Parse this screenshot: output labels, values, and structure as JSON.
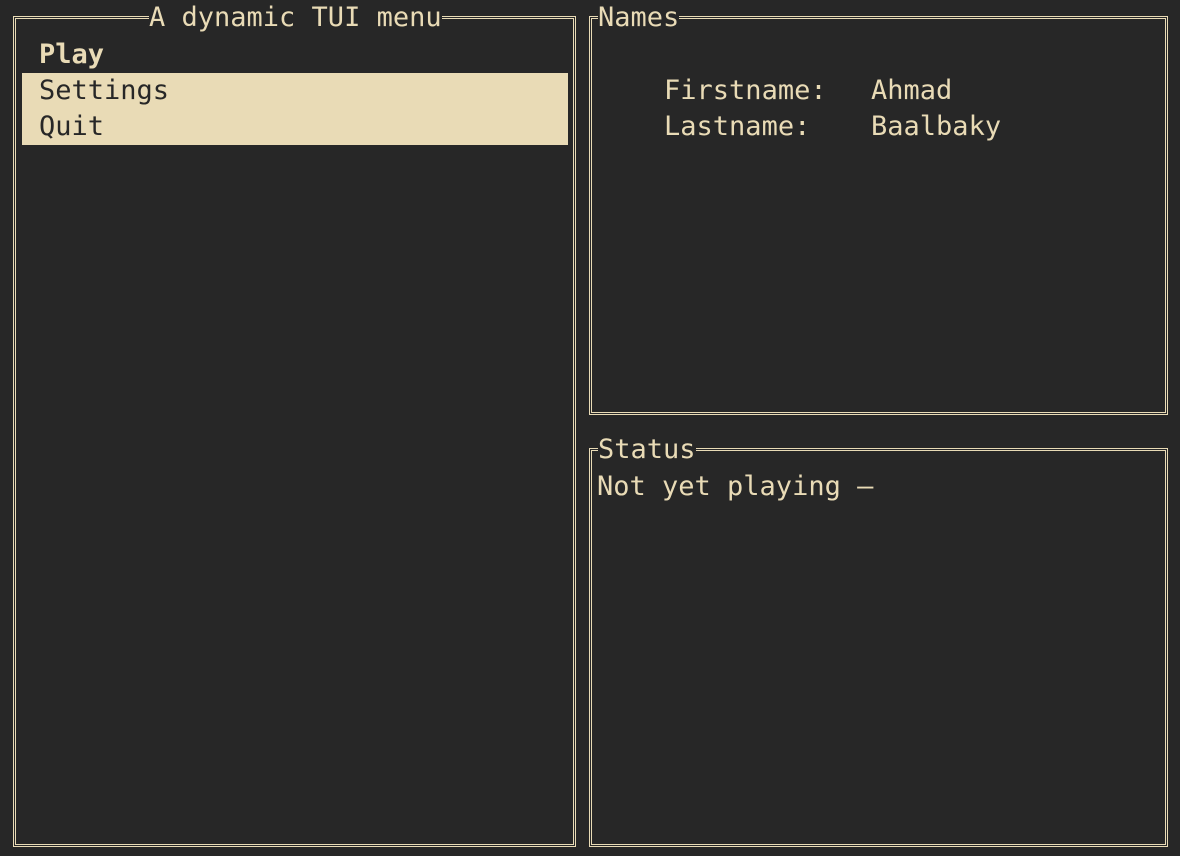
{
  "menu": {
    "title": "A dynamic TUI menu",
    "items": [
      {
        "label": "Play"
      },
      {
        "label": "Settings"
      },
      {
        "label": "Quit"
      }
    ]
  },
  "names": {
    "title": "Names",
    "firstname_label": "Firstname:",
    "firstname_value": "Ahmad",
    "lastname_label": "Lastname:",
    "lastname_value": "Baalbaky"
  },
  "status": {
    "title": "Status",
    "text": "Not yet playing –"
  },
  "colors": {
    "background": "#272727",
    "foreground": "#e9dbb6",
    "highlight_background": "#e9dbb6",
    "highlight_foreground": "#272727"
  }
}
